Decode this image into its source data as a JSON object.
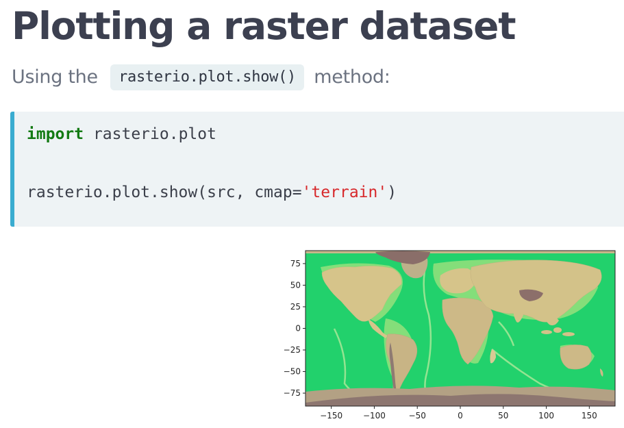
{
  "heading": "Plotting a raster dataset",
  "intro": {
    "before": "Using the",
    "code": "rasterio.plot.show()",
    "after": "method:"
  },
  "code_block": {
    "line1_keyword": "import",
    "line1_rest": " rasterio.plot",
    "line2_prefix": "rasterio.plot.show(src, cmap=",
    "line2_string": "'terrain'",
    "line2_suffix": ")"
  },
  "colors": {
    "code_accent": "#3aacd0",
    "keyword": "#137a13",
    "string": "#d7282b"
  },
  "chart_data": {
    "type": "heatmap",
    "colormap": "terrain",
    "xticks": [
      "−150",
      "−100",
      "−50",
      "0",
      "50",
      "100",
      "150"
    ],
    "yticks": [
      "75",
      "50",
      "25",
      "0",
      "−25",
      "−50",
      "−75"
    ],
    "x_tick_values": [
      -150,
      -100,
      -50,
      0,
      50,
      100,
      150
    ],
    "y_tick_values": [
      75,
      50,
      25,
      0,
      -25,
      -50,
      -75
    ],
    "xlim": [
      -180,
      180
    ],
    "ylim": [
      -90,
      90
    ]
  }
}
